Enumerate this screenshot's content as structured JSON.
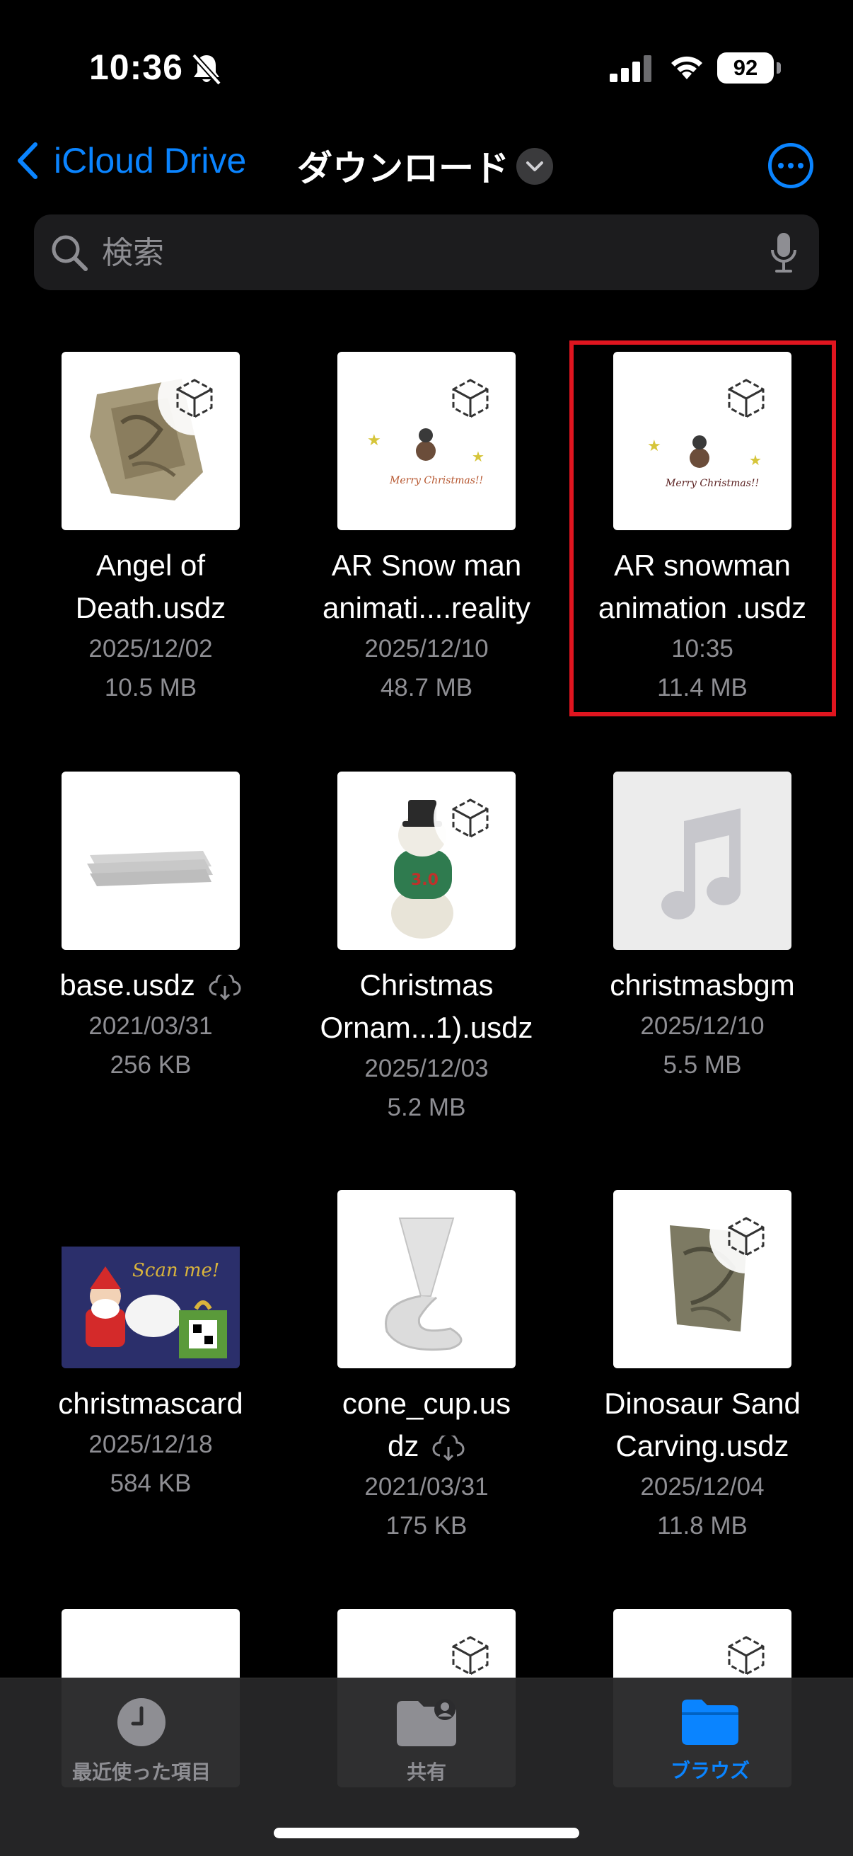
{
  "status": {
    "time": "10:36",
    "battery": "92"
  },
  "nav": {
    "back_label": "iCloud Drive",
    "title": "ダウンロード"
  },
  "search": {
    "placeholder": "検索"
  },
  "files": [
    {
      "name": "Angel of Death.usdz",
      "line1": "Angel of",
      "line2": "Death.usdz",
      "date": "2025/12/02",
      "size": "10.5 MB"
    },
    {
      "name": "AR Snow man animati....reality",
      "line1": "AR Snow man",
      "line2": "animati....reality",
      "date": "2025/12/10",
      "size": "48.7 MB"
    },
    {
      "name": "AR snowman animation .usdz",
      "line1": "AR snowman",
      "line2": "animation .usdz",
      "date": "10:35",
      "size": "11.4 MB"
    },
    {
      "name": "base.usdz",
      "line1": "base.usdz",
      "date": "2021/03/31",
      "size": "256 KB"
    },
    {
      "name": "Christmas Ornam...1).usdz",
      "line1": "Christmas",
      "line2": "Ornam...1).usdz",
      "date": "2025/12/03",
      "size": "5.2 MB"
    },
    {
      "name": "christmasbgm",
      "line1": "christmasbgm",
      "date": "2025/12/10",
      "size": "5.5 MB"
    },
    {
      "name": "christmascard",
      "line1": "christmascard",
      "date": "2025/12/18",
      "size": "584 KB"
    },
    {
      "name": "cone_cup.usdz",
      "line1": "cone_cup.us",
      "line2": "dz",
      "date": "2021/03/31",
      "size": "175 KB"
    },
    {
      "name": "Dinosaur Sand Carving.usdz",
      "line1": "Dinosaur Sand",
      "line2": "Carving.usdz",
      "date": "2025/12/04",
      "size": "11.8 MB"
    }
  ],
  "card": {
    "scan_text": "Scan me!"
  },
  "snow_card_text": "Merry Christmas!!",
  "ornament_text": "3.0",
  "tabs": [
    {
      "label": "最近使った項目",
      "icon": "clock-icon"
    },
    {
      "label": "共有",
      "icon": "shared-folder-icon"
    },
    {
      "label": "ブラウズ",
      "icon": "folder-icon"
    }
  ],
  "colors": {
    "accent": "#0a84ff",
    "highlight": "#e0151f",
    "background": "#000000"
  }
}
